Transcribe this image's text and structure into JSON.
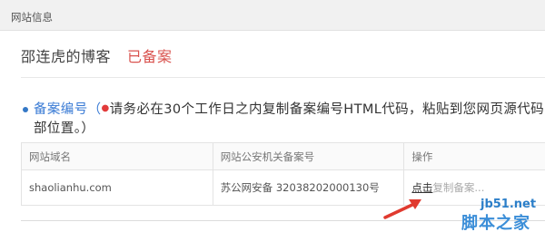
{
  "header": {
    "title": "网站信息"
  },
  "site": {
    "name": "邵连虎的博客",
    "status": "已备案"
  },
  "notice": {
    "label": "备案编号（",
    "text": "请务必在30个工作日之内复制备案编号HTML代码，粘贴到您网页源代码的底",
    "text_line2": "部位置。）"
  },
  "table": {
    "columns": [
      "网站域名",
      "网站公安机关备案号",
      "操作"
    ],
    "rows": [
      {
        "domain": "shaolianhu.com",
        "record": "苏公网安备 32038202000130号",
        "action": "点击",
        "action_more": "复制备案..."
      }
    ]
  },
  "watermark": {
    "site": "jb51.net",
    "brand": "脚本之家"
  },
  "colors": {
    "status": "#d9534f",
    "accent": "#3478c6",
    "arrow": "#e03a2f"
  }
}
